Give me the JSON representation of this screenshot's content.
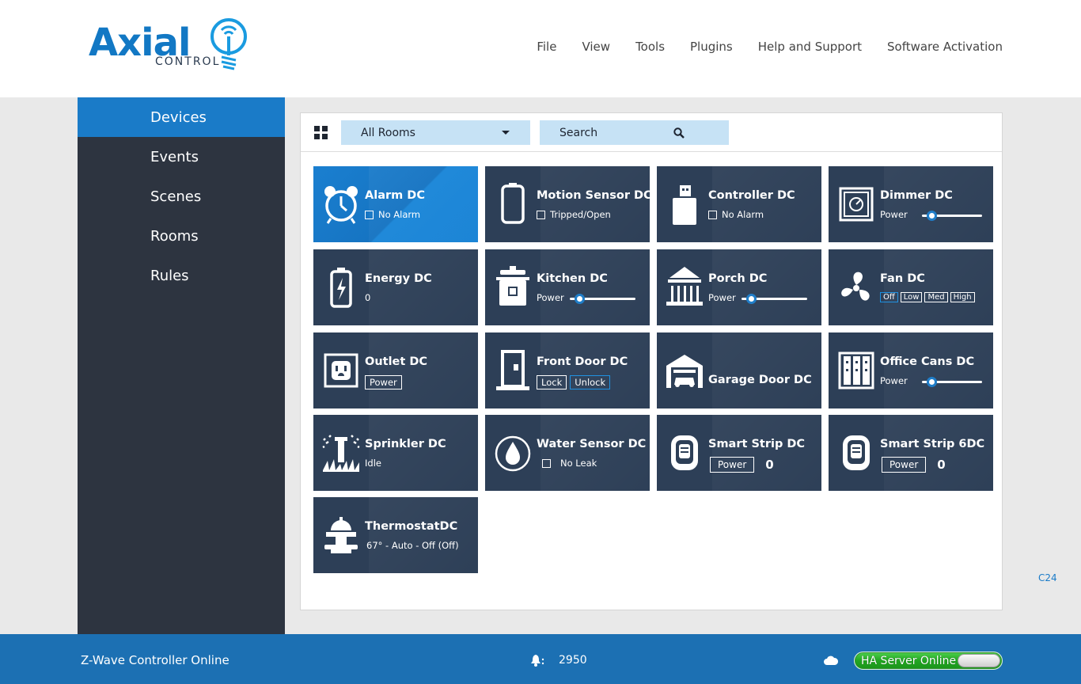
{
  "brand": {
    "name": "Axial",
    "sub": "CONTROL"
  },
  "menu": [
    "File",
    "View",
    "Tools",
    "Plugins",
    "Help and Support",
    "Software Activation"
  ],
  "sidebar": {
    "items": [
      "Devices",
      "Events",
      "Scenes",
      "Rooms",
      "Rules"
    ],
    "active": "Devices"
  },
  "toolbar": {
    "rooms_label": "All Rooms",
    "search_label": "Search"
  },
  "tiles": [
    {
      "name": "Alarm DC",
      "icon": "alarm-clock-icon",
      "sub": "No Alarm"
    },
    {
      "name": "Motion Sensor DC",
      "icon": "motion-sensor-icon",
      "sub": "Tripped/Open"
    },
    {
      "name": "Controller DC",
      "icon": "usb-controller-icon",
      "sub": "No Alarm"
    },
    {
      "name": "Dimmer DC",
      "icon": "dimmer-icon",
      "sub": "Power"
    },
    {
      "name": "Energy DC",
      "icon": "battery-icon",
      "sub": "0"
    },
    {
      "name": "Kitchen DC",
      "icon": "cooking-pot-icon",
      "sub": "Power"
    },
    {
      "name": "Porch DC",
      "icon": "porch-icon",
      "sub": "Power"
    },
    {
      "name": "Fan DC",
      "icon": "fan-icon",
      "options": [
        "Off",
        "Low",
        "Med",
        "High"
      ]
    },
    {
      "name": "Outlet DC",
      "icon": "outlet-icon",
      "button": "Power"
    },
    {
      "name": "Front Door DC",
      "icon": "door-icon",
      "buttons": [
        "Lock",
        "Unlock"
      ]
    },
    {
      "name": "Garage Door DC",
      "icon": "garage-icon"
    },
    {
      "name": "Office Cans DC",
      "icon": "office-cans-icon",
      "sub": "Power"
    },
    {
      "name": "Sprinkler DC",
      "icon": "sprinkler-icon",
      "sub": "Idle"
    },
    {
      "name": "Water Sensor DC",
      "icon": "water-drop-icon",
      "sub": "No Leak"
    },
    {
      "name": "Smart Strip DC",
      "icon": "smart-strip-icon",
      "button": "Power",
      "count": "0"
    },
    {
      "name": "Smart Strip 6DC",
      "icon": "smart-strip-icon",
      "button": "Power",
      "count": "0"
    },
    {
      "name": "ThermostatDC",
      "icon": "thermostat-icon",
      "sub": "67° - Auto - Off (Off)"
    }
  ],
  "corner_label": "C24",
  "status": {
    "controller": "Z-Wave Controller Online",
    "alert_count": "2950",
    "server": "HA Server Online"
  },
  "colors": {
    "accent": "#1a7bc8",
    "tile": "#2d3f57",
    "sidebar": "#2d3440",
    "status_green": "#22a622"
  }
}
